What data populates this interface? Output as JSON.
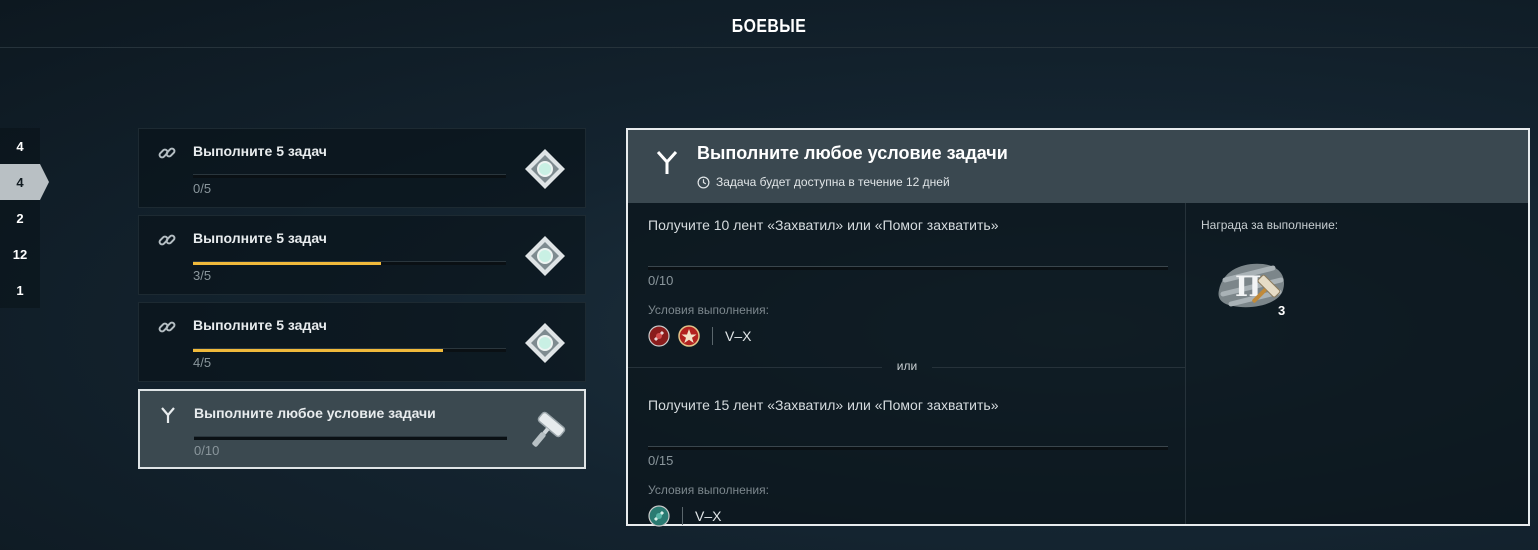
{
  "header": {
    "title": "БОЕВЫЕ"
  },
  "side_tabs": [
    {
      "label": "4",
      "active": false
    },
    {
      "label": "4",
      "active": true
    },
    {
      "label": "2",
      "active": false
    },
    {
      "label": "12",
      "active": false
    },
    {
      "label": "1",
      "active": false
    }
  ],
  "tasks": [
    {
      "title": "Выполните 5 задач",
      "progress": "0/5",
      "fraction": 0,
      "icon": "link-icon",
      "reward_icon": "diamond-badge-icon"
    },
    {
      "title": "Выполните 5 задач",
      "progress": "3/5",
      "fraction": 0.6,
      "icon": "link-icon",
      "reward_icon": "diamond-badge-icon"
    },
    {
      "title": "Выполните 5 задач",
      "progress": "4/5",
      "fraction": 0.8,
      "icon": "link-icon",
      "reward_icon": "diamond-badge-icon"
    },
    {
      "title": "Выполните любое условие задачи",
      "progress": "0/10",
      "fraction": 0,
      "icon": "fork-icon",
      "reward_icon": "paint-roller-icon"
    }
  ],
  "detail": {
    "title": "Выполните любое условие задачи",
    "subtitle": "Задача будет доступна в течение 12 дней",
    "conditions": [
      {
        "text": "Получите 10 лент «Захватил» или «Помог захватить»",
        "progress": "0/10",
        "label": "Условия выполнения:",
        "tier": "V–X",
        "badges": [
          "red-shell-badge-icon",
          "red-star-badge-icon"
        ]
      },
      {
        "text": "Получите 15 лент «Захватил» или «Помог захватить»",
        "progress": "0/15",
        "label": "Условия выполнения:",
        "tier": "V–X",
        "badges": [
          "teal-shell-badge-icon"
        ]
      }
    ],
    "or_text": "или",
    "reward_label": "Награда за выполнение:",
    "reward_count": "3",
    "accent_color": "#f0b93b"
  }
}
